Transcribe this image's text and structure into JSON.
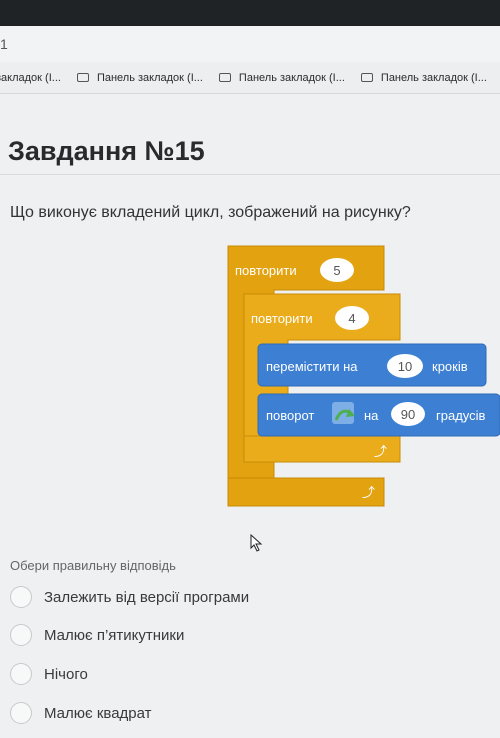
{
  "browser": {
    "tab_fragment": "1",
    "bookmarks": [
      "закладок (І...",
      "Панель закладок (І...",
      "Панель закладок (І...",
      "Панель закладок (І..."
    ]
  },
  "page": {
    "title": "Завдання №15",
    "question": "Що виконує вкладений цикл, зображений на рисунку?"
  },
  "blocks": {
    "repeat_outer_label": "повторити",
    "repeat_outer_value": "5",
    "repeat_inner_label": "повторити",
    "repeat_inner_value": "4",
    "move_label": "перемістити на",
    "move_value": "10",
    "move_unit": "кроків",
    "turn_label": "поворот",
    "turn_on": "на",
    "turn_value": "90",
    "turn_unit": "градусів",
    "colors": {
      "control": "#e3a20f",
      "motion": "#3d7fd3"
    }
  },
  "answers": {
    "prompt": "Обери правильну відповідь",
    "options": [
      "Залежить від версії програми",
      "Малює п’ятикутники",
      "Нічого",
      "Малює квадрат"
    ]
  }
}
